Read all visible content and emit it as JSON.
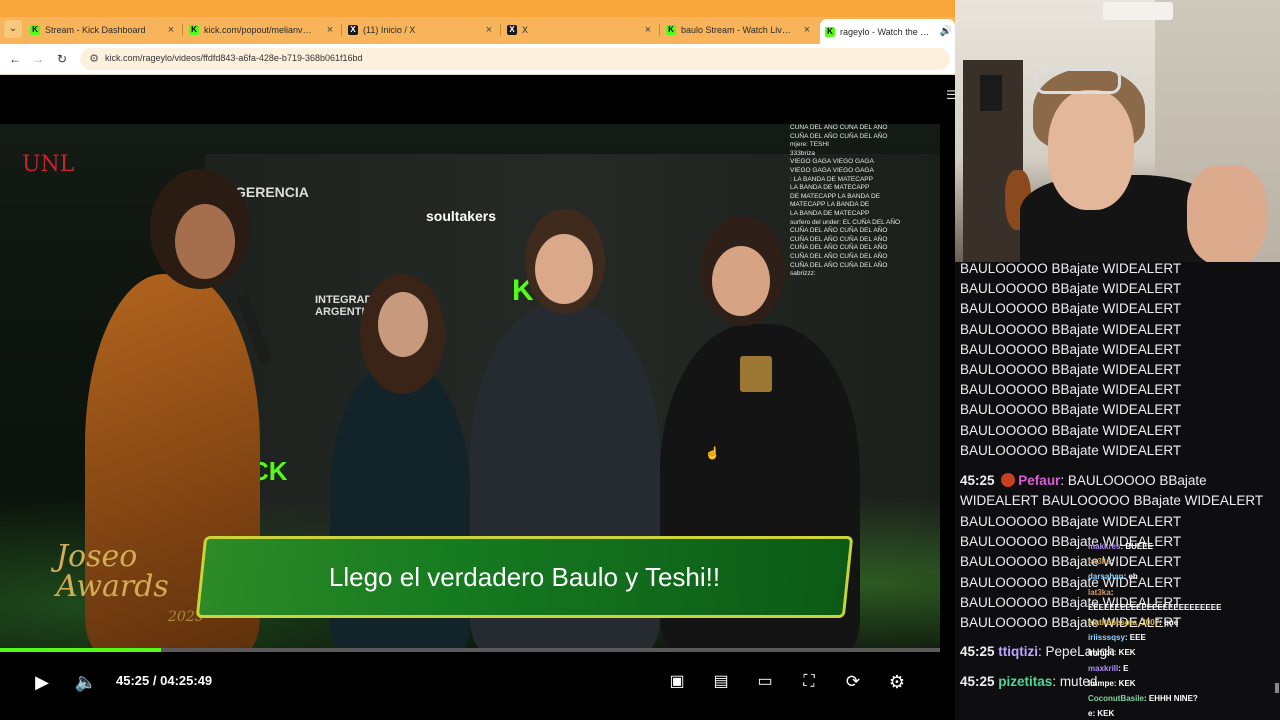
{
  "browser": {
    "tab_menu_icon": "chevron-down-icon",
    "tabs": [
      {
        "title": "Stream - Kick Dashboard",
        "favicon": "kick"
      },
      {
        "title": "kick.com/popout/melianvalen/chat",
        "favicon": "kick"
      },
      {
        "title": "(11) Inicio / X",
        "favicon": "x"
      },
      {
        "title": "X",
        "favicon": "x"
      },
      {
        "title": "baulo Stream - Watch Live on Kick",
        "favicon": "kick"
      },
      {
        "title": "rageylo - Watch the VOD on Kick",
        "favicon": "kick",
        "active": true
      }
    ],
    "url": "kick.com/rageylo/videos/ffdfd843-a6fa-428e-b719-368b061f16bd"
  },
  "video": {
    "caption": "Llego el verdadero Baulo y Teshi!!",
    "event_logo": "Joseo",
    "event_logo_2": "Awards",
    "event_year": "2025",
    "sponsor_1": "soultakers",
    "sponsor_2": "INTEGRADOS ARGENTINOS",
    "sponsor_3": "GERENCIA",
    "overlay_chat": [
      "CUÑA DEL AÑO CUÑA DEL AÑO",
      "CUÑA DEL AÑO CUÑA DEL AÑO",
      "mjere: TESHI",
      "333briza",
      "VIEGO GAGA VIEGO GAGA",
      "VIEGO GAGA VIEGO GAGA",
      ": LA BANDA DE MATECAPP",
      "LA BANDA DE MATECAPP",
      "DE MATECAPP LA BANDA DE",
      "MATECAPP LA BANDA DE",
      "LA BANDA DE MATECAPP",
      "surfero del under: EL CUÑA DEL AÑO",
      "CUÑA DEL AÑO CUÑA DEL AÑO",
      "CUÑA DEL AÑO CUÑA DEL AÑO",
      "CUÑA DEL AÑO CUÑA DEL AÑO",
      "CUÑA DEL AÑO CUÑA DEL AÑO",
      "CUÑA DEL AÑO CUÑA DEL AÑO",
      "sabrizzz:"
    ]
  },
  "player": {
    "current_time": "45:25",
    "separator": "/",
    "duration": "04:25:49",
    "progress_fraction": 0.171,
    "accent_color": "#53fc18"
  },
  "chat": {
    "repeat_text": "BAULOOOOO BBajate WIDEALERT",
    "messages": [
      {
        "time": "45:25",
        "user": "Pefaur",
        "user_color": "#e05bd6",
        "text_1": ": BAULOOOOO BBajate",
        "text_2": "WIDEALERT BAULOOOOO BBajate WIDEALERT"
      },
      {
        "time": "45:25",
        "user": "ttiqtizi",
        "user_color": "#bca6ff",
        "text_1": ": PepeLaugh"
      },
      {
        "time": "45:25",
        "user": "pizetitas",
        "user_color": "#4fd49a",
        "text_1": ": muted"
      }
    ],
    "overlay": [
      {
        "user": "makkres",
        "text": ": BUEEE"
      },
      {
        "user": "lat3ka",
        "text": ": "
      },
      {
        "user": "darsahan",
        "text": ": eh"
      },
      {
        "user": "lat3ka",
        "text": ": "
      },
      {
        "user": "",
        "text": "EEEEEEEEEEEEEEEEEEEEEEEEE"
      },
      {
        "user": "elatitebesota_2007",
        "text": ": que"
      },
      {
        "user": "iriisssqsy",
        "text": ": EEE"
      },
      {
        "user": "lmmpe",
        "text": ": KEK"
      },
      {
        "user": "maxkrill",
        "text": ": E"
      },
      {
        "user": "lmmpe",
        "text": ": KEK"
      },
      {
        "user": "CoconutBasile",
        "text": ": EHHH NINE?"
      },
      {
        "user": "e",
        "text": ": KEK"
      }
    ]
  }
}
